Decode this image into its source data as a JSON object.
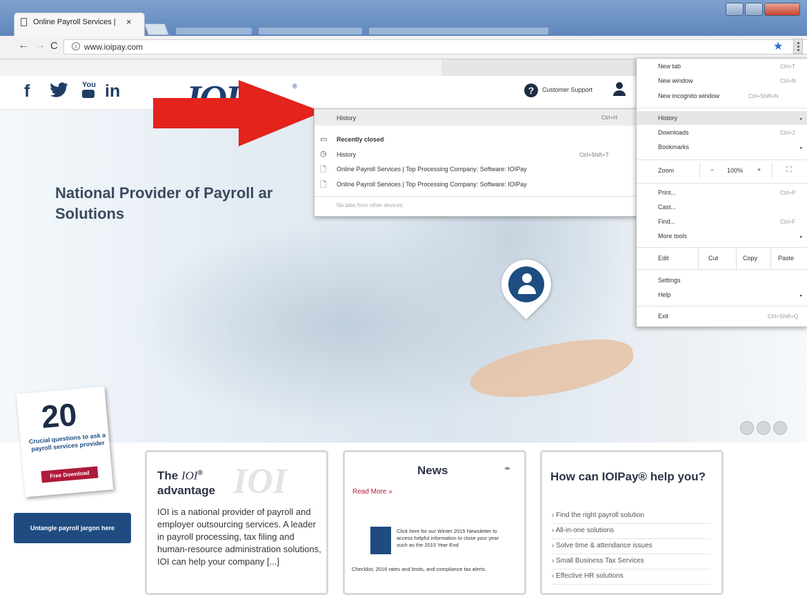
{
  "browser": {
    "tab_title": "Online Payroll Services |",
    "tab_close": "×",
    "url": "www.ioipay.com",
    "info_glyph": "i",
    "back_glyph": "←",
    "forward_glyph": "→",
    "reload_glyph": "C",
    "bookmark_glyph": "★"
  },
  "site": {
    "social": [
      "f",
      "🐦",
      "You",
      "in"
    ],
    "logo": "IOI",
    "logo_mark": "®",
    "support_glyph": "?",
    "support_label": "Customer Support",
    "account_glyph": "👤",
    "headline": "National Provider of Payroll ar Solutions"
  },
  "promo": {
    "number": "20",
    "text": "Crucial questions to ask a payroll services provider",
    "button": "Free Download"
  },
  "jargon_button": "Untangle payroll jargon here",
  "advantage_card": {
    "title_pre": "The ",
    "brand": "IOI",
    "mark": "®",
    "title_post": "advantage",
    "watermark": "IOI",
    "body": "IOI is a national provider of payroll and employer outsourcing services. A leader in payroll processing, tax filing and human-resource administration solutions, IOI can help your company [...]"
  },
  "news_card": {
    "title": "News",
    "arrows": "◂▸",
    "read_more": "Read More »",
    "text": "Click here for our Winter 2015 Newsletter to access helpful information to close your year such as the 2015 Year End",
    "text2": "Checklist, 2016 rates and limits, and compliance tax alerts."
  },
  "help_card": {
    "title": "How can IOIPay® help you?",
    "items": [
      "Find the right payroll solution",
      "All-in-one solutions",
      "Solve time & attendance issues",
      "Small Business Tax Services",
      "Effective HR solutions"
    ]
  },
  "history_menu": {
    "header": "History",
    "header_shortcut": "Ctrl+H",
    "recently_closed": "Recently closed",
    "history_item": "History",
    "history_shortcut": "Ctrl+Shift+T",
    "pages": [
      "Online Payroll Services | Top Processing Company: Software: IOIPay",
      "Online Payroll Services | Top Processing Company: Software: IOIPay"
    ],
    "other_devices": "No tabs from other devices"
  },
  "chrome_menu": {
    "new_tab": "New tab",
    "new_tab_sc": "Ctrl+T",
    "new_window": "New window",
    "new_window_sc": "Ctrl+N",
    "incognito": "New incognito window",
    "incognito_sc": "Ctrl+Shift+N",
    "history": "History",
    "downloads": "Downloads",
    "downloads_sc": "Ctrl+J",
    "bookmarks": "Bookmarks",
    "zoom": "Zoom",
    "zoom_minus": "−",
    "zoom_value": "100%",
    "zoom_plus": "+",
    "fullscreen": "⛶",
    "print": "Print...",
    "print_sc": "Ctrl+P",
    "cast": "Cast...",
    "find": "Find...",
    "find_sc": "Ctrl+F",
    "more_tools": "More tools",
    "edit": "Edit",
    "cut": "Cut",
    "copy": "Copy",
    "paste": "Paste",
    "settings": "Settings",
    "help": "Help",
    "exit": "Exit",
    "exit_sc": "Ctrl+Shift+Q"
  },
  "colors": {
    "arrow": "#e3231c",
    "brand_navy": "#1c3f72",
    "accent_red": "#b01a3a"
  }
}
